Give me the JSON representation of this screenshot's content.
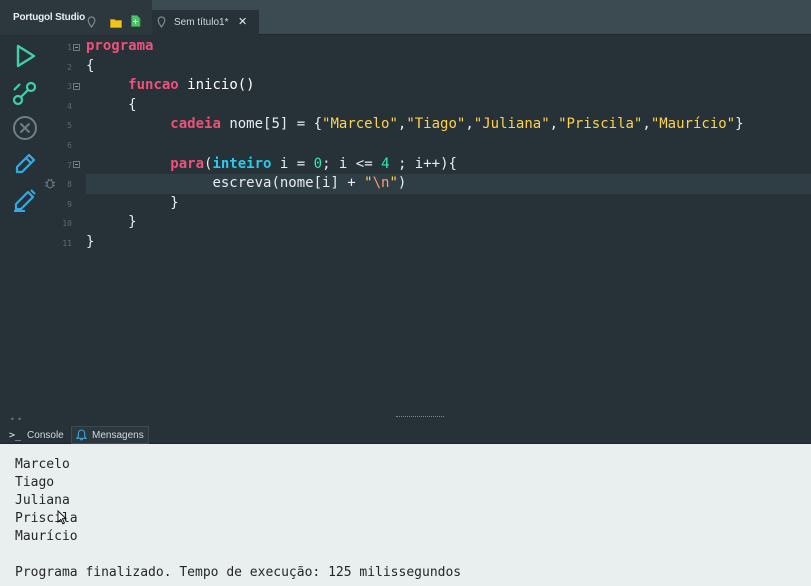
{
  "tabs": {
    "home_label": "Portugol Studio",
    "file_label": "Sem título1*",
    "close_symbol": "✕"
  },
  "toolbar": {
    "icons": [
      "play-icon",
      "step-icon",
      "stop-icon",
      "edit-icon",
      "pencil-icon"
    ]
  },
  "editor": {
    "line_numbers": [
      "1",
      "2",
      "3",
      "4",
      "5",
      "6",
      "7",
      "8",
      "9",
      "10",
      "11"
    ],
    "current_line": 8,
    "tokens": {
      "programa": "programa",
      "open_brace": "{",
      "close_brace": "}",
      "funcao": "funcao",
      "inicio_sig": "inicio()",
      "cadeia": "cadeia",
      "decl": "nome[5] = {",
      "names": [
        "\"Marcelo\"",
        "\"Tiago\"",
        "\"Juliana\"",
        "\"Priscila\"",
        "\"Maurício\""
      ],
      "comma": ",",
      "para": "para",
      "paren_open": "(",
      "inteiro": "inteiro",
      "init": " i = ",
      "zero": "0",
      "cond": "; i <= ",
      "four": "4",
      "incr": " ; i++){",
      "escreva": "escreva(nome[i] + ",
      "quote_open": "\"",
      "newline_escape": "\\n",
      "quote_close": "\"",
      "paren_close": ")"
    }
  },
  "bottom_tabs": {
    "console_prompt": ">_",
    "console_label": "Console",
    "messages_label": "Mensagens"
  },
  "console": {
    "output": [
      "Marcelo",
      "Tiago",
      "Juliana",
      "Priscila",
      "Maurício"
    ],
    "status": "Programa finalizado. Tempo de execução: 125 milissegundos"
  },
  "colors": {
    "keyword": "#f0507a",
    "type_keyword": "#2ec8e8",
    "string": "#ffd24d",
    "number": "#2ee8b8",
    "accent_icon": "#3fd0a8"
  }
}
